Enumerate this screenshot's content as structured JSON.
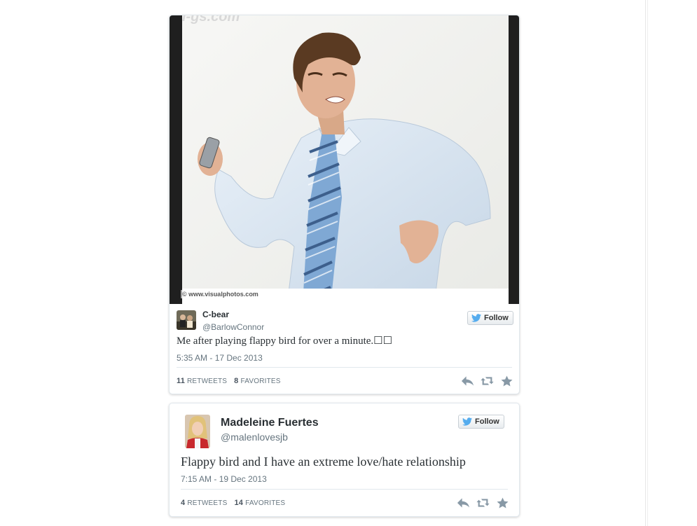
{
  "tweets": [
    {
      "media": {
        "credit": "© www.visualphotos.com"
      },
      "author": {
        "name": "C-bear",
        "handle": "@BarlowConnor"
      },
      "follow_label": "Follow",
      "text": "Me after playing flappy bird for over a minute.☐☐",
      "timestamp": "5:35 AM - 17 Dec 2013",
      "stats": {
        "retweets_count": "11",
        "retweets_label": "RETWEETS",
        "favorites_count": "8",
        "favorites_label": "FAVORITES"
      },
      "actions": [
        "reply-icon",
        "retweet-icon",
        "favorite-icon"
      ]
    },
    {
      "author": {
        "name": "Madeleine Fuertes",
        "handle": "@malenlovesjb"
      },
      "follow_label": "Follow",
      "text": "Flappy bird and I have an extreme love/hate relationship",
      "timestamp": "7:15 AM - 19 Dec 2013",
      "stats": {
        "retweets_count": "4",
        "retweets_label": "RETWEETS",
        "favorites_count": "14",
        "favorites_label": "FAVORITES"
      },
      "actions": [
        "reply-icon",
        "retweet-icon",
        "favorite-icon"
      ]
    }
  ],
  "colors": {
    "twitter_blue": "#55acee",
    "icon_gray": "#8899a6",
    "text_dark": "#292f33",
    "text_muted": "#66757f"
  }
}
